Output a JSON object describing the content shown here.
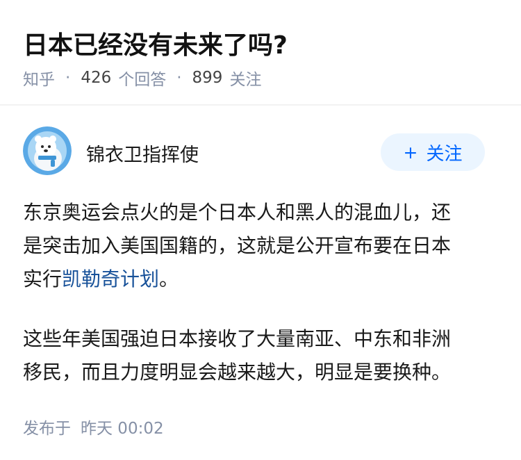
{
  "question": {
    "title": "日本已经没有未来了吗?",
    "source": "知乎",
    "answer_count": "426",
    "answer_label": "个回答",
    "follower_count": "899",
    "follower_label": "关注"
  },
  "answer": {
    "author": "锦衣卫指挥使",
    "follow_plus": "+",
    "follow_label": "关注",
    "paragraph1": {
      "line1": "东京奥运会点火的是个日本人和黑人的混血儿，还",
      "line2": "是突击加入美国国籍的，这就是公开宣布要在日本",
      "line3_prefix": "实行",
      "link_text": "凯勒奇计划",
      "line3_suffix": "。"
    },
    "paragraph2": {
      "line1": "这些年美国强迫日本接收了大量南亚、中东和非洲",
      "line2": "移民，而且力度明显会越来越大，明显是要换种。"
    },
    "publish_label": "发布于",
    "publish_time": "昨天 00:02"
  },
  "colors": {
    "accent": "#0066ff",
    "link": "#175199",
    "meta": "#8590a6",
    "follow_bg": "#ebf5ff"
  },
  "icons": {
    "avatar": "polar-bear-avatar-icon"
  }
}
